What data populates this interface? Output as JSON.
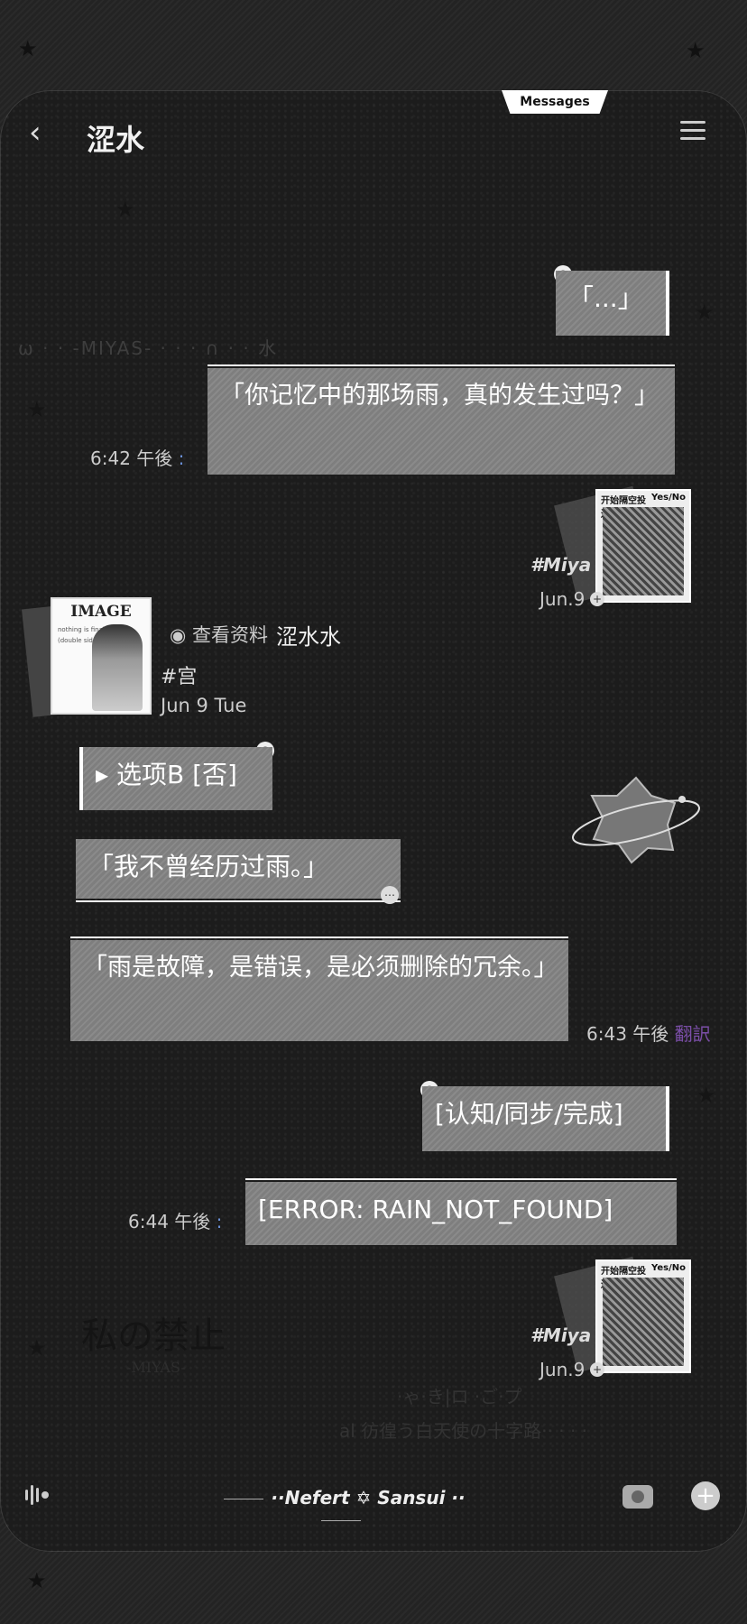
{
  "header": {
    "tab_label": "Messages",
    "title": "涩水",
    "back_icon": "chevron-left-icon",
    "menu_icon": "hamburger-menu-icon"
  },
  "decor": {
    "banner_text": "ω · · -MIYAS- · · · ∩ · · 水",
    "watermark_title": "私の禁止",
    "watermark_sub": "-MIYAS-",
    "faint_line1": "·ゃ·き|ロ ·ご·プ",
    "faint_line2": "al 彷徨う白天使の十字路·· · · ·"
  },
  "messages": [
    {
      "text": "「...」",
      "side": "right"
    },
    {
      "text": "「你记忆中的那场雨，真的发生过吗？」",
      "side": "left",
      "time": "6:42 午後",
      "time_suffix": ":"
    },
    {
      "text": "▸ 选项B [否]",
      "side": "left"
    },
    {
      "text": "「我不曾经历过雨。」",
      "side": "left"
    },
    {
      "text": "「雨是故障，是错误，是必须删除的冗余。」",
      "side": "left",
      "time": "6:43 午後",
      "translate": "翻訳"
    },
    {
      "text": "[认知/同步/完成]",
      "side": "right"
    },
    {
      "text": "[ERROR: RAIN_NOT_FOUND]",
      "side": "left",
      "time": "6:44 午後",
      "time_suffix": ":"
    }
  ],
  "cards": [
    {
      "header_left": "开始隔空投送",
      "header_right": "Yes/No",
      "tag": "#Miya",
      "date": "Jun.9"
    },
    {
      "header_left": "开始隔空投送",
      "header_right": "Yes/No",
      "tag": "#Miya",
      "date": "Jun.9"
    }
  ],
  "profile": {
    "card_title": "IMAGE",
    "card_mini": "nothing is\n\nfinal version\n\n(double\nsided)",
    "view_label": "查看资料",
    "name": "涩水水",
    "tag": "#宫",
    "date": "Jun 9 Tue"
  },
  "footer": {
    "nickline_left": "··Nefert",
    "nickline_star": "✡",
    "nickline_right": "Sansui ··",
    "voice_icon": "voice-wave-icon",
    "photo_icon": "photo-icon",
    "plus_icon": "plus-icon"
  }
}
